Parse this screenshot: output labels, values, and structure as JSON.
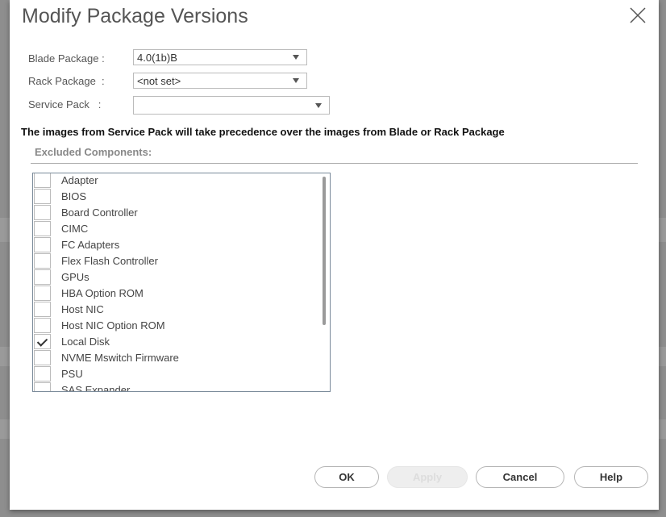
{
  "dialog": {
    "title": "Modify Package Versions",
    "close_icon": "close-x-icon",
    "fields": [
      {
        "label": "Blade Package :",
        "value": "4.0(1b)B"
      },
      {
        "label": "Rack Package  :",
        "value": "<not set>"
      },
      {
        "label": "Service Pack   :",
        "value": ""
      }
    ],
    "note": "The images from Service Pack will take precedence over the images from Blade or Rack Package",
    "excluded_label": "Excluded Components:",
    "components": [
      {
        "label": "Adapter",
        "checked": false
      },
      {
        "label": "BIOS",
        "checked": false
      },
      {
        "label": "Board Controller",
        "checked": false
      },
      {
        "label": "CIMC",
        "checked": false
      },
      {
        "label": "FC Adapters",
        "checked": false
      },
      {
        "label": "Flex Flash Controller",
        "checked": false
      },
      {
        "label": "GPUs",
        "checked": false
      },
      {
        "label": "HBA Option ROM",
        "checked": false
      },
      {
        "label": "Host NIC",
        "checked": false
      },
      {
        "label": "Host NIC Option ROM",
        "checked": false
      },
      {
        "label": "Local Disk",
        "checked": true
      },
      {
        "label": "NVME Mswitch Firmware",
        "checked": false
      },
      {
        "label": "PSU",
        "checked": false
      },
      {
        "label": "SAS Expander",
        "checked": false
      }
    ],
    "buttons": {
      "ok": "OK",
      "apply": "Apply",
      "cancel": "Cancel",
      "help": "Help"
    }
  }
}
